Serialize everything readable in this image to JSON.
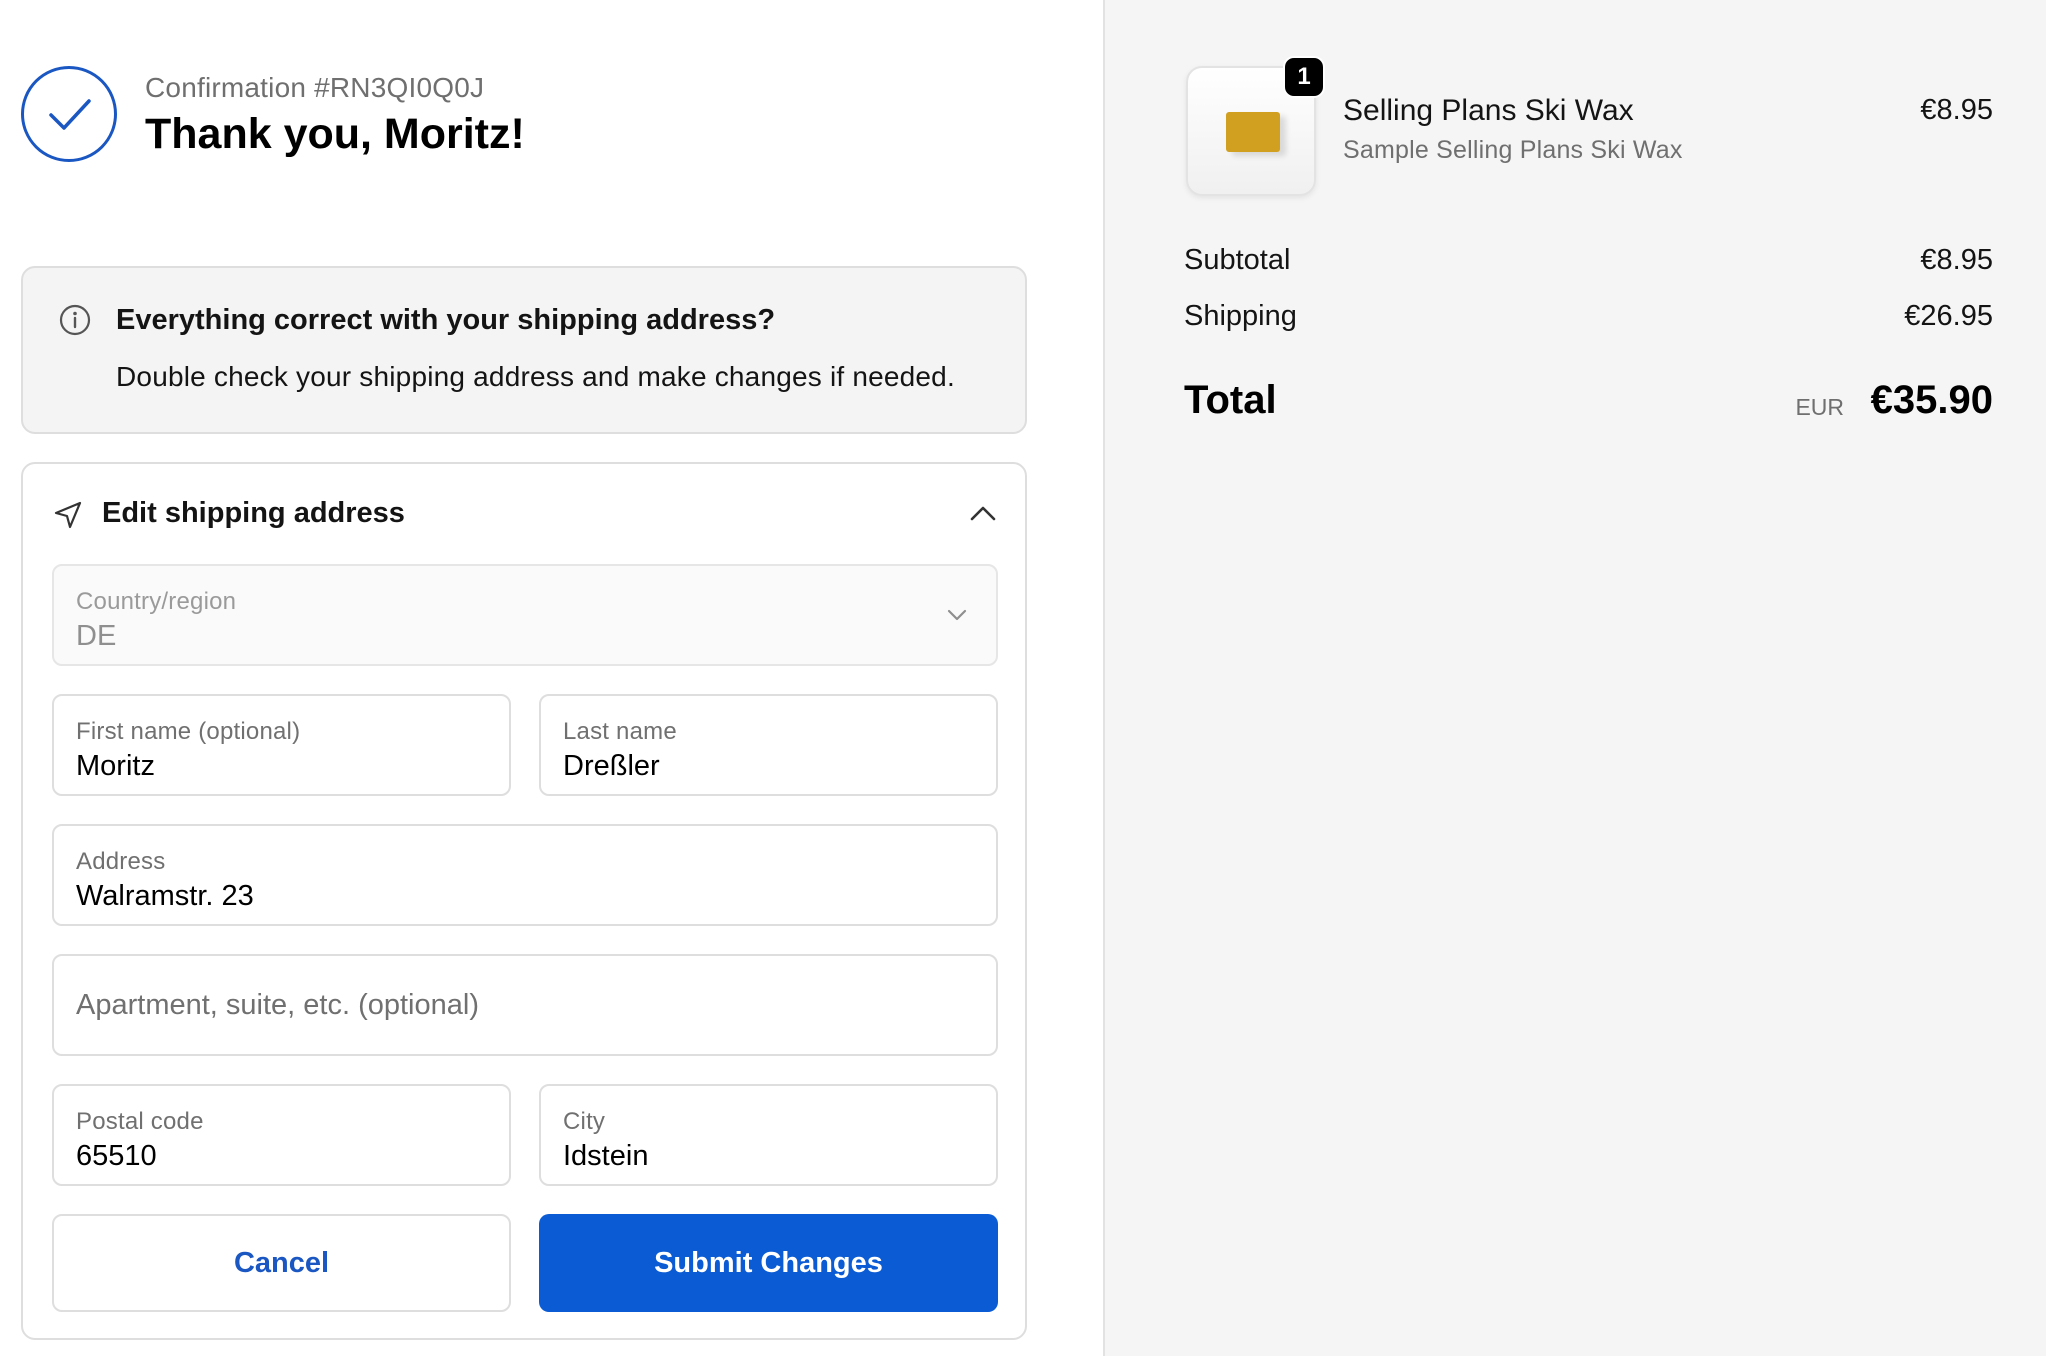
{
  "header": {
    "confirmation": "Confirmation #RN3QI0Q0J",
    "thank_you": "Thank you, Moritz!"
  },
  "notice": {
    "title": "Everything correct with your shipping address?",
    "text": "Double check your shipping address and make changes if needed."
  },
  "edit_address": {
    "title": "Edit shipping address",
    "country": {
      "label": "Country/region",
      "value": "DE"
    },
    "first_name": {
      "label": "First name (optional)",
      "value": "Moritz"
    },
    "last_name": {
      "label": "Last name",
      "value": "Dreßler"
    },
    "address": {
      "label": "Address",
      "value": "Walramstr. 23"
    },
    "apartment": {
      "placeholder": "Apartment, suite, etc. (optional)"
    },
    "postal_code": {
      "label": "Postal code",
      "value": "65510"
    },
    "city": {
      "label": "City",
      "value": "Idstein"
    },
    "cancel_label": "Cancel",
    "submit_label": "Submit Changes"
  },
  "order": {
    "item": {
      "name": "Selling Plans Ski Wax",
      "subtitle": "Sample Selling Plans Ski Wax",
      "price": "€8.95",
      "quantity": "1"
    },
    "subtotal_label": "Subtotal",
    "subtotal_value": "€8.95",
    "shipping_label": "Shipping",
    "shipping_value": "€26.95",
    "total_label": "Total",
    "total_currency": "EUR",
    "total_value": "€35.90"
  },
  "colors": {
    "accent": "#0a5bd4",
    "check": "#1a57c2",
    "summary_bg": "#f5f5f5"
  }
}
